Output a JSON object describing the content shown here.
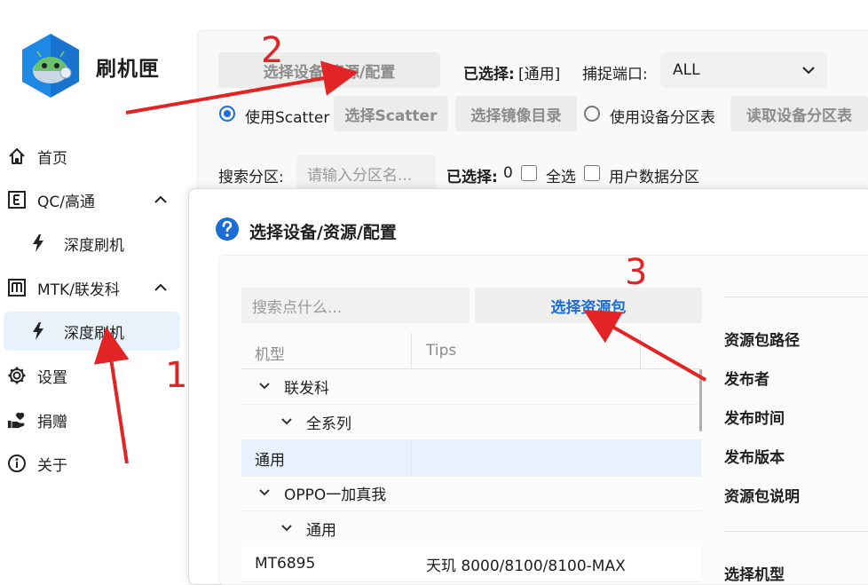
{
  "app": {
    "title": "刷机匣"
  },
  "sidebar": {
    "items": [
      {
        "label": "首页"
      },
      {
        "label": "QC/高通"
      },
      {
        "label": "深度刷机"
      },
      {
        "label": "MTK/联发科"
      },
      {
        "label": "深度刷机"
      },
      {
        "label": "设置"
      },
      {
        "label": "捐赠"
      },
      {
        "label": "关于"
      }
    ]
  },
  "toolbar": {
    "select_device_button": "选择设备/资源/配置",
    "selected_label": "已选择:",
    "selected_value": "[通用]",
    "port_label": "捕捉端口:",
    "port_value": "ALL",
    "use_scatter": "使用Scatter",
    "select_scatter_button": "选择Scatter",
    "select_image_dir_button": "选择镜像目录",
    "use_partition_table": "使用设备分区表",
    "read_partition_table_button": "读取设备分区表",
    "search_partition_label": "搜索分区:",
    "search_partition_placeholder": "请输入分区名...",
    "selected_count_label": "已选择:",
    "selected_count_value": "0",
    "select_all": "全选",
    "user_data_partition": "用户数据分区"
  },
  "dialog": {
    "title": "选择设备/资源/配置",
    "search_placeholder": "搜索点什么...",
    "select_package_button": "选择资源包",
    "columns": [
      "机型",
      "Tips"
    ],
    "rows": [
      {
        "level": 0,
        "expandable": true,
        "label": "联发科",
        "tips": ""
      },
      {
        "level": 1,
        "expandable": true,
        "label": "全系列",
        "tips": ""
      },
      {
        "level": 2,
        "expandable": false,
        "label": "通用",
        "tips": "",
        "selected": true
      },
      {
        "level": 0,
        "expandable": true,
        "label": "OPPO一加真我",
        "tips": ""
      },
      {
        "level": 1,
        "expandable": true,
        "label": "通用",
        "tips": ""
      },
      {
        "level": 2,
        "expandable": false,
        "label": "MT6895",
        "tips": "天玑 8000/8100/8100-MAX"
      }
    ],
    "info_labels": [
      "资源包路径",
      "发布者",
      "发布时间",
      "发布版本",
      "资源包说明",
      "选择机型"
    ]
  },
  "annotations": {
    "step1": "1",
    "step2": "2",
    "step3": "3"
  },
  "colors": {
    "accent": "#1c6cd8",
    "annotation": "#e32424",
    "selected_row": "#e8f2fc"
  }
}
